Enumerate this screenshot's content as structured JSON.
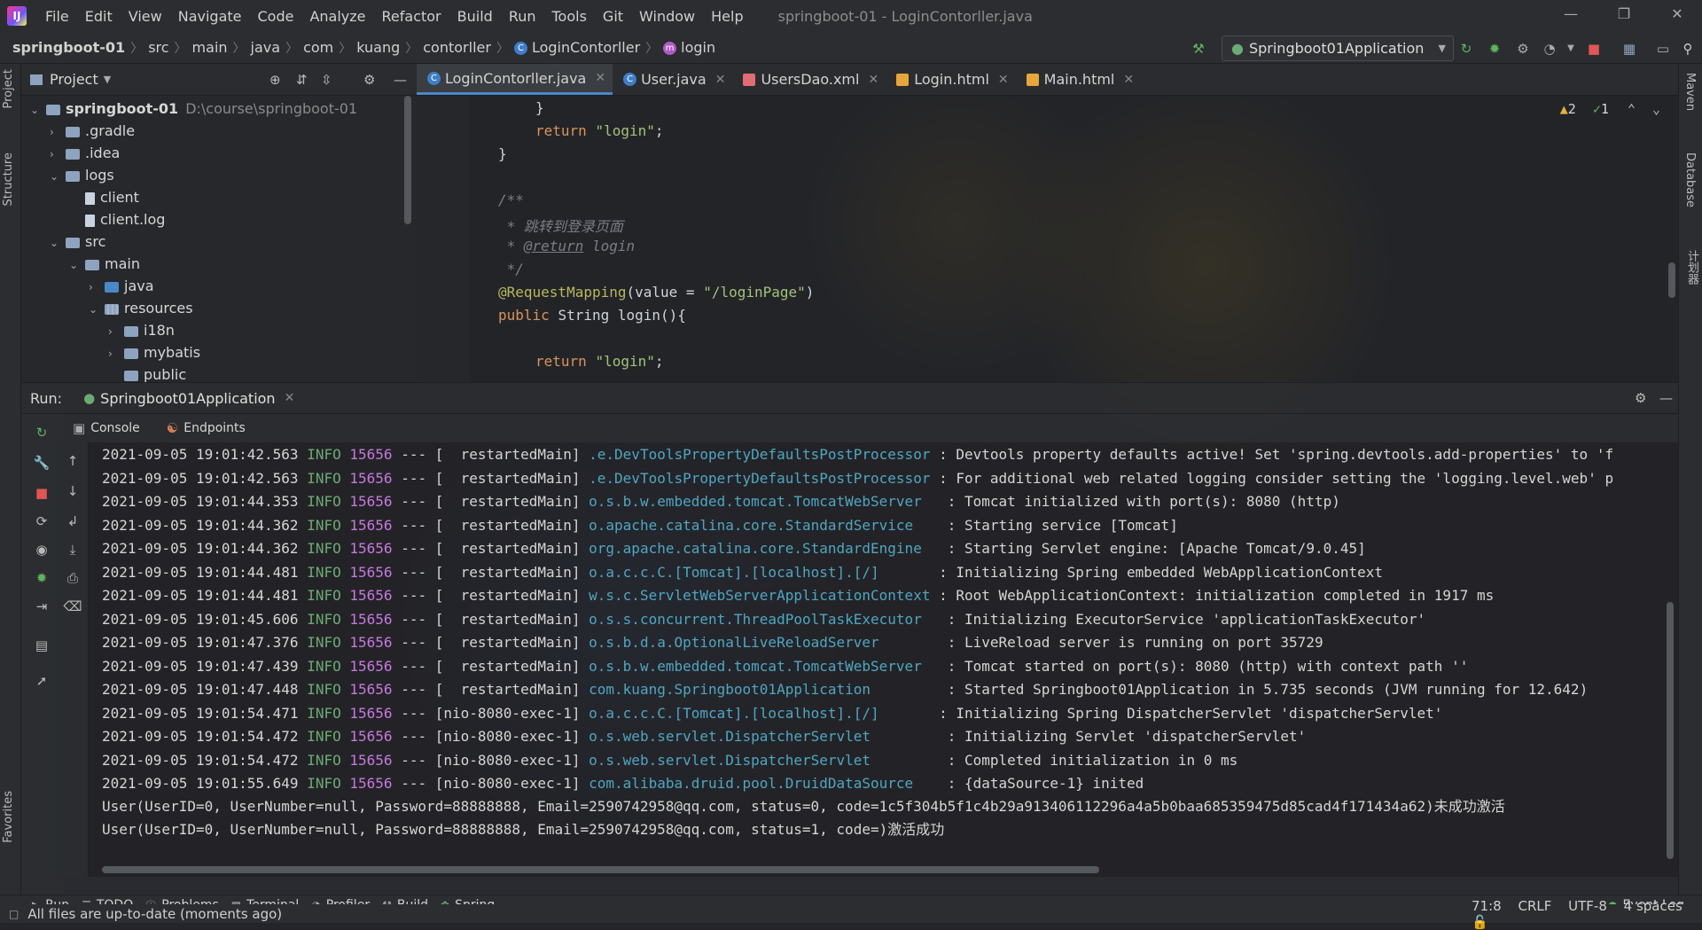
{
  "menu": {
    "items": [
      "File",
      "Edit",
      "View",
      "Navigate",
      "Code",
      "Analyze",
      "Refactor",
      "Build",
      "Run",
      "Tools",
      "Git",
      "Window",
      "Help"
    ],
    "window_title": "springboot-01 - LoginContorller.java"
  },
  "breadcrumb": [
    "springboot-01",
    "src",
    "main",
    "java",
    "com",
    "kuang",
    "contorller",
    "LoginContorller",
    "login"
  ],
  "run_config": "Springboot01Application",
  "left_tabs": [
    "Project",
    "Structure",
    "Favorites"
  ],
  "right_tabs": [
    "Maven",
    "Database",
    "计划器"
  ],
  "project": {
    "title": "Project",
    "root_name": "springboot-01",
    "root_path": "D:\\course\\springboot-01",
    "items": [
      ".gradle",
      ".idea",
      "logs",
      "client",
      "client.log",
      "src",
      "main",
      "java",
      "resources",
      "i18n",
      "mybatis",
      "public"
    ]
  },
  "editor": {
    "tabs": [
      "LoginContorller.java",
      "User.java",
      "UsersDao.xml",
      "Login.html",
      "Main.html"
    ],
    "warnings": "2",
    "checks": "1",
    "code": {
      "l1": "}",
      "l2_kw": "return ",
      "l2_str": "\"login\"",
      "l2_end": ";",
      "l3": "}",
      "l4": "/**",
      "l5": " * 跳转到登录页面",
      "l6_prefix": " * ",
      "l6_tag": "@return",
      "l6_rest": " login",
      "l7": " */",
      "l8_ann": "@RequestMapping",
      "l8_a": "(value = ",
      "l8_str": "\"/loginPage\"",
      "l8_b": ")",
      "l9_kw": "public ",
      "l9_rest": "String login(){",
      "l10_kw": "return ",
      "l10_str": "\"login\"",
      "l10_end": ";"
    }
  },
  "run": {
    "label": "Run:",
    "tab": "Springboot01Application",
    "subtabs": [
      "Console",
      "Endpoints"
    ],
    "log": [
      {
        "ts": "2021-09-05 19:01:42.563",
        "level": "INFO",
        "pid": "15656",
        "sep": "---",
        "thread": "[  restartedMain]",
        "logger": ".e.DevToolsPropertyDefaultsPostProcessor",
        "msg": ": Devtools property defaults active! Set 'spring.devtools.add-properties' to 'f"
      },
      {
        "ts": "2021-09-05 19:01:42.563",
        "level": "INFO",
        "pid": "15656",
        "sep": "---",
        "thread": "[  restartedMain]",
        "logger": ".e.DevToolsPropertyDefaultsPostProcessor",
        "msg": ": For additional web related logging consider setting the 'logging.level.web' p"
      },
      {
        "ts": "2021-09-05 19:01:44.353",
        "level": "INFO",
        "pid": "15656",
        "sep": "---",
        "thread": "[  restartedMain]",
        "logger": "o.s.b.w.embedded.tomcat.TomcatWebServer  ",
        "msg": ": Tomcat initialized with port(s): 8080 (http)"
      },
      {
        "ts": "2021-09-05 19:01:44.362",
        "level": "INFO",
        "pid": "15656",
        "sep": "---",
        "thread": "[  restartedMain]",
        "logger": "o.apache.catalina.core.StandardService   ",
        "msg": ": Starting service [Tomcat]"
      },
      {
        "ts": "2021-09-05 19:01:44.362",
        "level": "INFO",
        "pid": "15656",
        "sep": "---",
        "thread": "[  restartedMain]",
        "logger": "org.apache.catalina.core.StandardEngine  ",
        "msg": ": Starting Servlet engine: [Apache Tomcat/9.0.45]"
      },
      {
        "ts": "2021-09-05 19:01:44.481",
        "level": "INFO",
        "pid": "15656",
        "sep": "---",
        "thread": "[  restartedMain]",
        "logger": "o.a.c.c.C.[Tomcat].[localhost].[/]      ",
        "msg": ": Initializing Spring embedded WebApplicationContext"
      },
      {
        "ts": "2021-09-05 19:01:44.481",
        "level": "INFO",
        "pid": "15656",
        "sep": "---",
        "thread": "[  restartedMain]",
        "logger": "w.s.c.ServletWebServerApplicationContext",
        "msg": ": Root WebApplicationContext: initialization completed in 1917 ms"
      },
      {
        "ts": "2021-09-05 19:01:45.606",
        "level": "INFO",
        "pid": "15656",
        "sep": "---",
        "thread": "[  restartedMain]",
        "logger": "o.s.s.concurrent.ThreadPoolTaskExecutor  ",
        "msg": ": Initializing ExecutorService 'applicationTaskExecutor'"
      },
      {
        "ts": "2021-09-05 19:01:47.376",
        "level": "INFO",
        "pid": "15656",
        "sep": "---",
        "thread": "[  restartedMain]",
        "logger": "o.s.b.d.a.OptionalLiveReloadServer       ",
        "msg": ": LiveReload server is running on port 35729"
      },
      {
        "ts": "2021-09-05 19:01:47.439",
        "level": "INFO",
        "pid": "15656",
        "sep": "---",
        "thread": "[  restartedMain]",
        "logger": "o.s.b.w.embedded.tomcat.TomcatWebServer  ",
        "msg": ": Tomcat started on port(s): 8080 (http) with context path ''"
      },
      {
        "ts": "2021-09-05 19:01:47.448",
        "level": "INFO",
        "pid": "15656",
        "sep": "---",
        "thread": "[  restartedMain]",
        "logger": "com.kuang.Springboot01Application        ",
        "msg": ": Started Springboot01Application in 5.735 seconds (JVM running for 12.642)"
      },
      {
        "ts": "2021-09-05 19:01:54.471",
        "level": "INFO",
        "pid": "15656",
        "sep": "---",
        "thread": "[nio-8080-exec-1]",
        "logger": "o.a.c.c.C.[Tomcat].[localhost].[/]      ",
        "msg": ": Initializing Spring DispatcherServlet 'dispatcherServlet'"
      },
      {
        "ts": "2021-09-05 19:01:54.472",
        "level": "INFO",
        "pid": "15656",
        "sep": "---",
        "thread": "[nio-8080-exec-1]",
        "logger": "o.s.web.servlet.DispatcherServlet        ",
        "msg": ": Initializing Servlet 'dispatcherServlet'"
      },
      {
        "ts": "2021-09-05 19:01:54.472",
        "level": "INFO",
        "pid": "15656",
        "sep": "---",
        "thread": "[nio-8080-exec-1]",
        "logger": "o.s.web.servlet.DispatcherServlet        ",
        "msg": ": Completed initialization in 0 ms"
      },
      {
        "ts": "2021-09-05 19:01:55.649",
        "level": "INFO",
        "pid": "15656",
        "sep": "---",
        "thread": "[nio-8080-exec-1]",
        "logger": "com.alibaba.druid.pool.DruidDataSource   ",
        "msg": ": {dataSource-1} inited"
      }
    ],
    "plain": [
      "User(UserID=0, UserNumber=null, Password=88888888, Email=2590742958@qq.com, status=0, code=1c5f304b5f1c4b29a913406112296a4a5b0baa685359475d85cad4f171434a62)未成功激活",
      "User(UserID=0, UserNumber=null, Password=88888888, Email=2590742958@qq.com, status=1, code=)激活成功"
    ]
  },
  "bottom_tabs": [
    "Run",
    "TODO",
    "Problems",
    "Terminal",
    "Profiler",
    "Build",
    "Spring"
  ],
  "event_log": "Event Log",
  "status": {
    "message": "All files are up-to-date (moments ago)",
    "position": "71:8",
    "line_sep": "CRLF",
    "encoding": "UTF-8",
    "indent": "4 spaces"
  }
}
